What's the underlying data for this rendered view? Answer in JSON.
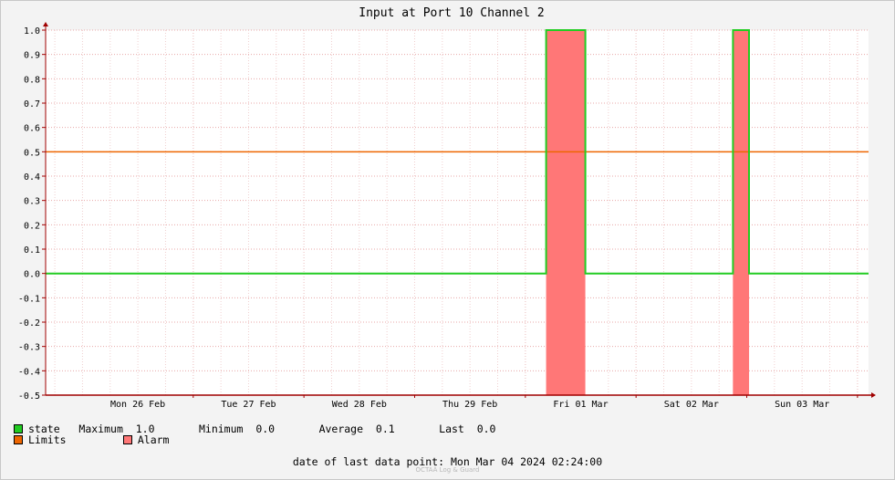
{
  "chart_data": {
    "type": "line",
    "title": "Input at Port 10 Channel 2",
    "ylim": [
      -0.5,
      1.0
    ],
    "y_ticks": [
      "1.0",
      "0.9",
      "0.8",
      "0.7",
      "0.6",
      "0.5",
      "0.4",
      "0.3",
      "0.2",
      "0.1",
      "0.0",
      "-0.1",
      "-0.2",
      "-0.3",
      "-0.4",
      "-0.5"
    ],
    "x_range": [
      "2024-02-25 16:00",
      "2024-03-04 02:24"
    ],
    "x_ticks": [
      {
        "label": "Mon 26 Feb",
        "t": "2024-02-26 12:00"
      },
      {
        "label": "Tue 27 Feb",
        "t": "2024-02-27 12:00"
      },
      {
        "label": "Wed 28 Feb",
        "t": "2024-02-28 12:00"
      },
      {
        "label": "Thu 29 Feb",
        "t": "2024-02-29 12:00"
      },
      {
        "label": "Fri 01 Mar",
        "t": "2024-03-01 12:00"
      },
      {
        "label": "Sat 02 Mar",
        "t": "2024-03-02 12:00"
      },
      {
        "label": "Sun 03 Mar",
        "t": "2024-03-03 12:00"
      }
    ],
    "series": [
      {
        "name": "state",
        "color": "#22cc22",
        "points": [
          [
            "2024-02-25 16:00",
            0.0
          ],
          [
            "2024-03-01 04:30",
            0.0
          ],
          [
            "2024-03-01 04:30",
            1.0
          ],
          [
            "2024-03-01 13:00",
            1.0
          ],
          [
            "2024-03-01 13:00",
            0.0
          ],
          [
            "2024-03-02 21:00",
            0.0
          ],
          [
            "2024-03-02 21:00",
            1.0
          ],
          [
            "2024-03-03 00:30",
            1.0
          ],
          [
            "2024-03-03 00:30",
            0.0
          ],
          [
            "2024-03-04 02:24",
            0.0
          ]
        ]
      },
      {
        "name": "Limits",
        "color": "#ee6600",
        "constant": 0.5
      }
    ],
    "alarm_periods": [
      [
        "2024-03-01 04:30",
        "2024-03-01 13:00"
      ],
      [
        "2024-03-02 21:00",
        "2024-03-03 00:30"
      ]
    ],
    "alarm_color": "#ff7777",
    "grid": true
  },
  "legend": {
    "state_label": "state",
    "state_color": "#22cc22",
    "maximum_label": "Maximum",
    "maximum_value": "1.0",
    "minimum_label": "Minimum",
    "minimum_value": "0.0",
    "average_label": "Average",
    "average_value": "0.1",
    "last_label": "Last",
    "last_value": "0.0",
    "limits_label": "Limits",
    "limits_color": "#ee6600",
    "alarm_label": "Alarm",
    "alarm_color": "#ff7777"
  },
  "footer": {
    "label": "date of last data point:",
    "value": "Mon Mar 04 2024 02:24:00",
    "watermark": "OCTAÄ Log & Guard"
  }
}
